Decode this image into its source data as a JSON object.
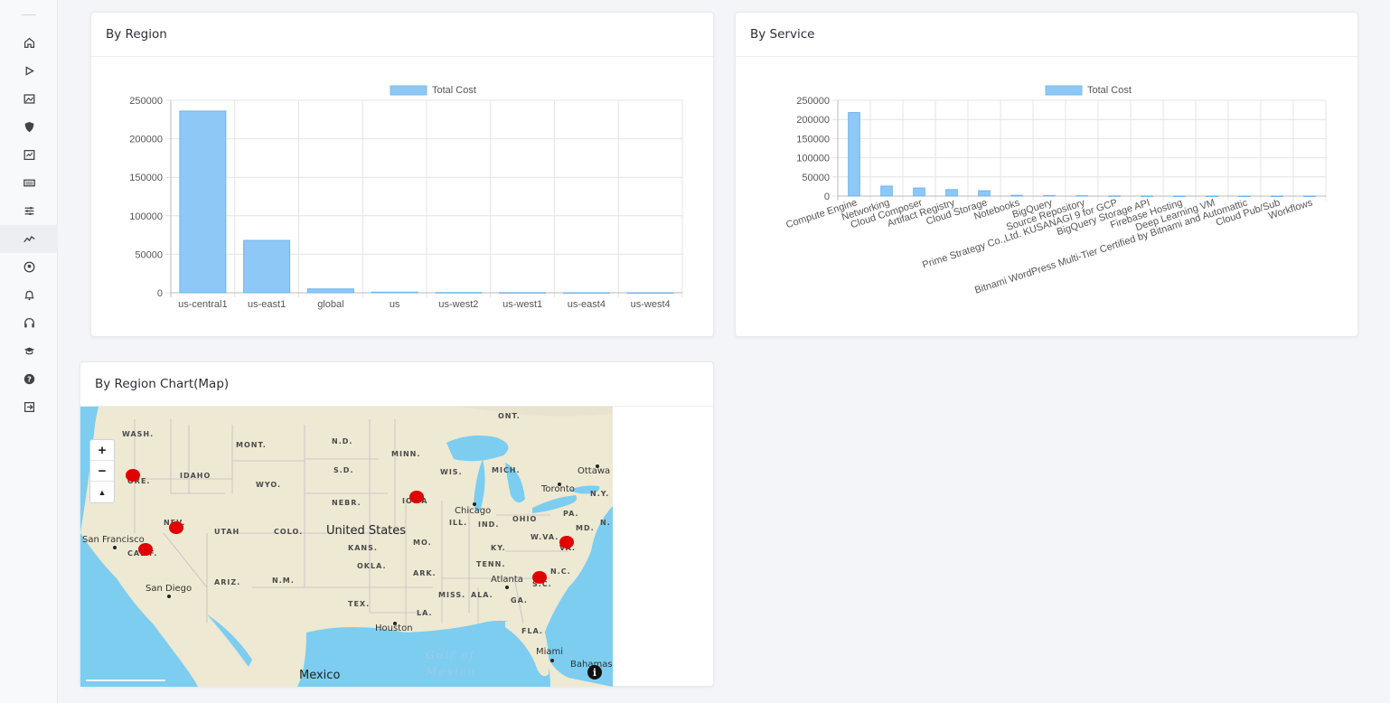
{
  "sidebar": {
    "items": [
      {
        "icon": "home-icon"
      },
      {
        "icon": "play-icon"
      },
      {
        "icon": "image-icon"
      },
      {
        "icon": "shield-icon"
      },
      {
        "icon": "report-icon"
      },
      {
        "icon": "keyboard-icon"
      },
      {
        "icon": "sliders-icon"
      },
      {
        "icon": "trend-chart-icon",
        "active": true
      },
      {
        "icon": "user-circle-icon"
      },
      {
        "icon": "bell-icon"
      },
      {
        "icon": "headset-icon"
      },
      {
        "icon": "graduation-cap-icon"
      },
      {
        "icon": "help-icon"
      },
      {
        "icon": "sign-out-icon"
      }
    ]
  },
  "cards": {
    "region": {
      "title": "By Region"
    },
    "service": {
      "title": "By Service"
    },
    "map": {
      "title": "By Region Chart(Map)"
    }
  },
  "chart_data": [
    {
      "type": "bar",
      "legend": [
        "Total Cost"
      ],
      "color": "#8ec8f6",
      "categories": [
        "us-central1",
        "us-east1",
        "global",
        "us",
        "us-west2",
        "us-west1",
        "us-east4",
        "us-west4"
      ],
      "series": [
        {
          "name": "Total Cost",
          "values": [
            236000,
            68000,
            5000,
            800,
            300,
            100,
            50,
            20
          ]
        }
      ],
      "ylim": [
        0,
        250000
      ],
      "yticks": [
        "250000",
        "200000",
        "150000",
        "100000",
        "50000",
        "0"
      ],
      "grid": true
    },
    {
      "type": "bar",
      "legend": [
        "Total Cost"
      ],
      "color": "#8ec8f6",
      "categories": [
        "Compute Engine",
        "Networking",
        "Cloud Composer",
        "Artifact Registry",
        "Cloud Storage",
        "Notebooks",
        "BigQuery",
        "Source Repository",
        "Prime Strategy Co.,Ltd. KUSANAGI 9 for GCP",
        "BigQuery Storage API",
        "Firebase Hosting",
        "Deep Learning VM",
        "Bitnami WordPress Multi-Tier Certified by Bitnami and Automattic",
        "Cloud Pub/Sub",
        "Workflows"
      ],
      "series": [
        {
          "name": "Total Cost",
          "values": [
            218000,
            26000,
            21000,
            17000,
            14000,
            2000,
            1500,
            1000,
            500,
            200,
            100,
            80,
            50,
            30,
            10
          ]
        }
      ],
      "ylim": [
        0,
        250000
      ],
      "yticks": [
        "250000",
        "200000",
        "150000",
        "100000",
        "50000",
        "0"
      ],
      "grid": true
    }
  ],
  "map": {
    "zoom_in": "+",
    "zoom_out": "−",
    "reset": "▲",
    "marker_color": "#e00000",
    "labels": {
      "states": [
        "WASH.",
        "MONT.",
        "N.D.",
        "MINN.",
        "ONT.",
        "IDAHO",
        "S.D.",
        "WIS.",
        "MICH.",
        "WYO.",
        "N.Y.",
        "ORE.",
        "NEBR.",
        "IOWA",
        "ILL.",
        "IND.",
        "OHIO",
        "PA.",
        "NEV.",
        "UTAH",
        "COLO.",
        "MO.",
        "KY.",
        "W.VA.",
        "VA.",
        "MD.",
        "N.",
        "CALIF.",
        "KANS.",
        "OKLA.",
        "TENN.",
        "N.C.",
        "ARIZ.",
        "N.M.",
        "ARK.",
        "S.C.",
        "MISS.",
        "ALA.",
        "GA.",
        "TEX.",
        "LA.",
        "FLA."
      ],
      "cities": [
        "Ottawa",
        "Toronto",
        "Chicago",
        "San Francisco",
        "San Diego",
        "Atlanta",
        "Houston",
        "Miami",
        "Bahamas"
      ],
      "country": "United States",
      "country2": "Mexico",
      "water": [
        "Gulf of",
        "Mexico"
      ]
    }
  }
}
